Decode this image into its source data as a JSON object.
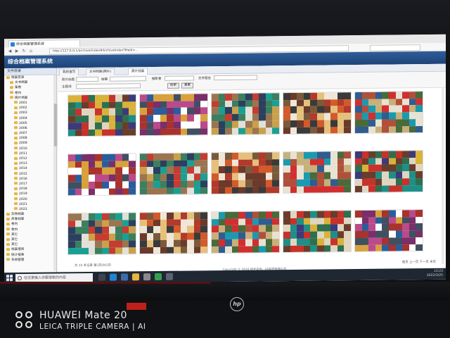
{
  "browser": {
    "tab_title": "综合档案管理系统",
    "url": "http://127.0.0.1/archive/index#ArchiveIndex?fileId=..."
  },
  "app": {
    "title": "综合档案管理系统"
  },
  "tree": {
    "title": "文件目录",
    "items": [
      "档案目录",
      "文书档案",
      "案卷",
      "卷内",
      "照片档案",
      "2001",
      "2002",
      "2003",
      "2004",
      "2005",
      "2006",
      "2007",
      "2008",
      "2009",
      "2010",
      "2011",
      "2012",
      "2013",
      "2014",
      "2015",
      "2016",
      "2017",
      "2018",
      "2019",
      "2020",
      "2021",
      "2022",
      "实物档案",
      "声像档案",
      "卷内",
      "卷内",
      "其它",
      "其它",
      "其它",
      "档案借阅",
      "统计报表",
      "系统管理"
    ]
  },
  "main": {
    "tabs": [
      "我的首页",
      "文书档案(照片)",
      "照片档案"
    ],
    "filters": {
      "label1": "照片标题",
      "label2": "拍摄",
      "label3": "摄影者",
      "label4": "文件题名",
      "label5": "主题词",
      "search_btn": "检索",
      "reset_btn": "重置"
    },
    "captions": [
      "",
      "",
      "",
      "",
      "",
      "",
      "",
      "",
      "",
      "",
      "",
      "",
      "",
      "",
      ""
    ],
    "pager_left": "共 15 条记录  第1页/共1页",
    "pager_right": "首页 上一页 下一页 末页",
    "copyright": "Copyright © 2016 技术支持：XX软件有限公司"
  },
  "taskbar": {
    "search_placeholder": "在这里输入你要搜索的内容",
    "time": "13:23",
    "date": "2022/3/25"
  },
  "camera": {
    "line1": "HUAWEI Mate 20",
    "line2": "LEICA TRIPLE CAMERA | AI"
  },
  "hp_logo": "hp"
}
